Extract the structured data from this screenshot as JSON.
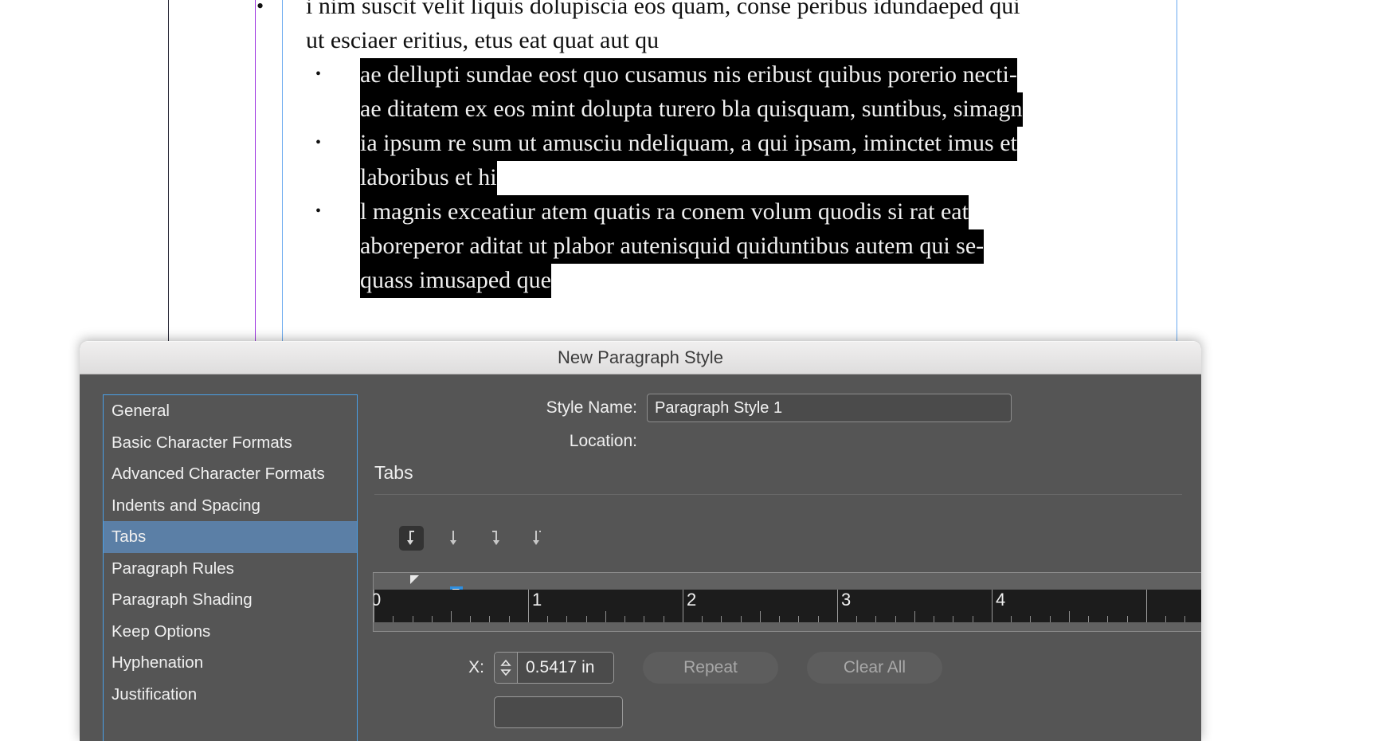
{
  "document": {
    "paragraphs": [
      {
        "level": 1,
        "highlighted": false,
        "lines": [
          "i nim suscit velit liquis dolupiscia eos quam, conse peribus idundaeped qui",
          "ut esciaer eritius, etus eat quat aut qu"
        ]
      },
      {
        "level": 2,
        "highlighted": true,
        "lines": [
          "ae dellupti sundae eost quo cusamus nis eribust quibus porerio necti-",
          "ae ditatem ex eos mint dolupta turero bla quisquam, suntibus, simagn"
        ]
      },
      {
        "level": 2,
        "highlighted": true,
        "lines": [
          "ia ipsum re sum ut amusciu ndeliquam, a qui ipsam, iminctet imus et",
          "laboribus et hi "
        ]
      },
      {
        "level": 2,
        "highlighted": true,
        "lines": [
          "l magnis exceatiur atem quatis ra conem volum quodis si rat eat",
          "aboreperor aditat ut plabor autenisquid quiduntibus autem qui se-",
          "quass imusaped que"
        ]
      }
    ],
    "bullet_glyph": "•",
    "guides": {
      "black": "#2b2b3a",
      "purple": "#9b30e0",
      "blue": "#6aaaf0"
    }
  },
  "dialog": {
    "title": "New Paragraph Style",
    "sidebar": {
      "items": [
        {
          "label": "General",
          "selected": false
        },
        {
          "label": "Basic Character Formats",
          "selected": false
        },
        {
          "label": "Advanced Character Formats",
          "selected": false
        },
        {
          "label": "Indents and Spacing",
          "selected": false
        },
        {
          "label": "Tabs",
          "selected": true
        },
        {
          "label": "Paragraph Rules",
          "selected": false
        },
        {
          "label": "Paragraph Shading",
          "selected": false
        },
        {
          "label": "Keep Options",
          "selected": false
        },
        {
          "label": "Hyphenation",
          "selected": false
        },
        {
          "label": "Justification",
          "selected": false
        }
      ],
      "selection_color": "#5b7fa6",
      "border_color": "#49a0e8"
    },
    "style_name": {
      "label": "Style Name:",
      "value": "Paragraph Style 1"
    },
    "location": {
      "label": "Location:",
      "value": ""
    },
    "panel": {
      "section_title": "Tabs",
      "tab_buttons": [
        {
          "name": "left-justified-tab-icon",
          "active": true
        },
        {
          "name": "center-justified-tab-icon",
          "active": false
        },
        {
          "name": "right-justified-tab-icon",
          "active": false
        },
        {
          "name": "align-to-decimal-tab-icon",
          "active": false
        }
      ],
      "ruler": {
        "numbers": [
          "0",
          "1",
          "2",
          "3",
          "4"
        ],
        "unit": "in",
        "tab_marker_color": "#2f8fe0"
      },
      "x_field": {
        "label": "X:",
        "value": "0.5417 in"
      },
      "repeat_button": "Repeat",
      "clear_all_button": "Clear All"
    }
  }
}
